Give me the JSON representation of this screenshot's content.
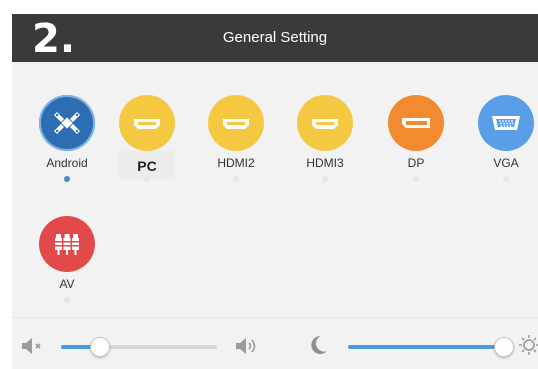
{
  "header": {
    "step_label": "2.",
    "title": "General Setting"
  },
  "sources": [
    {
      "label": "Android",
      "icon": "android-icon",
      "color": "#2d6eb3",
      "selected": true
    },
    {
      "label": "PC",
      "icon": "hdmi-port-icon",
      "color": "#f5c842",
      "selected": false
    },
    {
      "label": "HDMI2",
      "icon": "hdmi-port-icon",
      "color": "#f5c842",
      "selected": false
    },
    {
      "label": "HDMI3",
      "icon": "hdmi-port-icon",
      "color": "#f5c842",
      "selected": false
    },
    {
      "label": "DP",
      "icon": "displayport-icon",
      "color": "#f28a30",
      "selected": false
    },
    {
      "label": "VGA",
      "icon": "vga-port-icon",
      "color": "#5b9ee8",
      "selected": false
    },
    {
      "label": "AV",
      "icon": "av-rca-icon",
      "color": "#e24a4a",
      "selected": false
    }
  ],
  "controls": {
    "volume": {
      "mute_icon": "volume-mute-icon",
      "max_icon": "volume-high-icon",
      "level": 0.25
    },
    "brightness": {
      "min_icon": "moon-icon",
      "max_icon": "sun-icon",
      "level": 1.0
    },
    "accent_color": "#4a9be0"
  }
}
